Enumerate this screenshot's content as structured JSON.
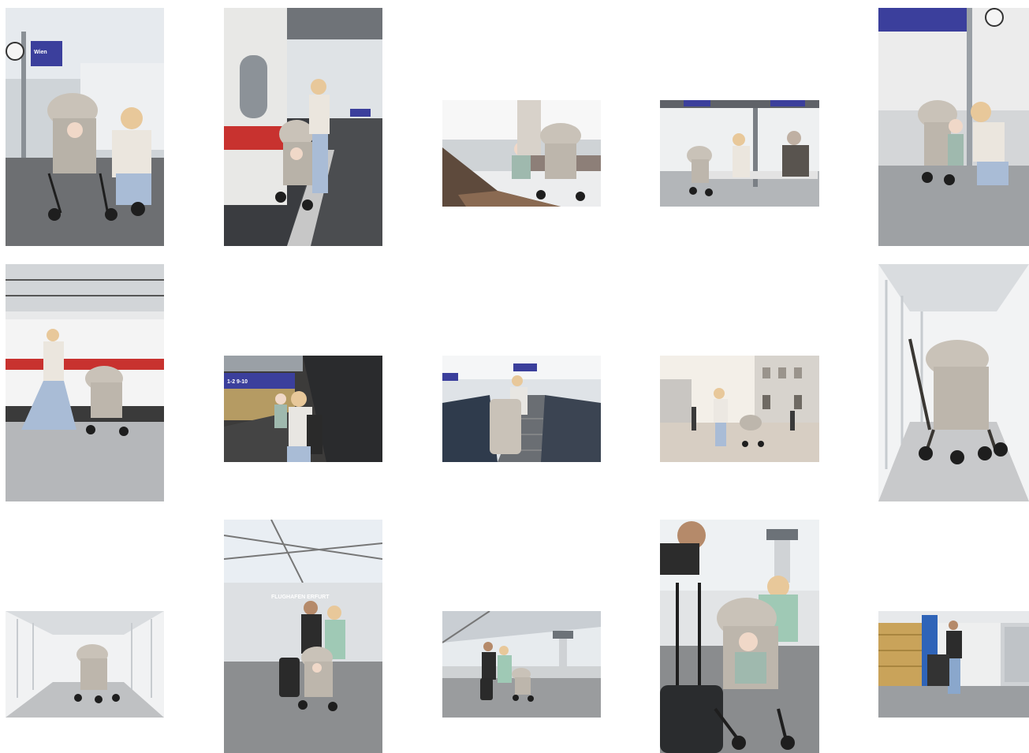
{
  "gallery": {
    "photos": [
      {
        "id": 1,
        "scene": "platform-crouching-mother",
        "sign": "Wien"
      },
      {
        "id": 2,
        "scene": "train-door-walking"
      },
      {
        "id": 3,
        "scene": "bench-toddler-standing"
      },
      {
        "id": 4,
        "scene": "bench-family-sitting"
      },
      {
        "id": 5,
        "scene": "platform-clock-toddler"
      },
      {
        "id": 6,
        "scene": "walking-past-train"
      },
      {
        "id": 7,
        "scene": "escalator-top-sign",
        "sign": "1-2 9-10"
      },
      {
        "id": 8,
        "scene": "escalator-stroller-folded"
      },
      {
        "id": 9,
        "scene": "station-plaza-backlit"
      },
      {
        "id": 10,
        "scene": "skywalk-stroller-close"
      },
      {
        "id": 11,
        "scene": "skywalk-stroller-far"
      },
      {
        "id": 12,
        "scene": "airport-entrance-family",
        "sign": "FLUGHAFEN ERFURT"
      },
      {
        "id": 13,
        "scene": "airport-tower-family"
      },
      {
        "id": 14,
        "scene": "airport-suitcase-closeup"
      },
      {
        "id": 15,
        "scene": "airport-checkin-fold"
      }
    ]
  },
  "colors": {
    "train_red": "#c8322f",
    "stroller_beige": "#c9c2b8",
    "frame_black": "#1e1e1e",
    "sign_blue": "#3b3f9c",
    "sky": "#e9eef3"
  }
}
